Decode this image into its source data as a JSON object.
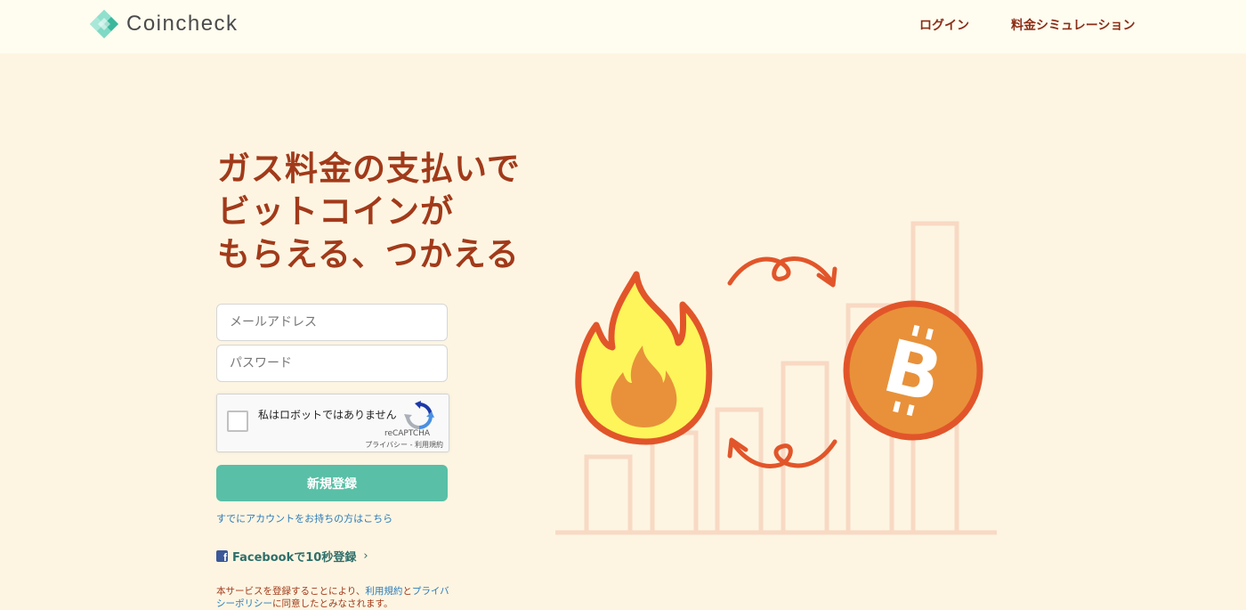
{
  "header": {
    "logo_text": "Coincheck",
    "nav": {
      "login": "ログイン",
      "fee_simulation": "料金シミュレーション"
    }
  },
  "hero": {
    "headline_lines": [
      "ガス料金の支払いで",
      "ビットコインが",
      "もらえる、つかえる"
    ]
  },
  "form": {
    "email_placeholder": "メールアドレス",
    "password_placeholder": "パスワード",
    "captcha": {
      "label": "私はロボットではありません",
      "brand": "reCAPTCHA",
      "terms": "プライバシー - 利用規約"
    },
    "register_label": "新規登録",
    "existing_account_link": "すでにアカウントをお持ちの方はこちら",
    "facebook_label": "Facebookで10秒登録",
    "facebook_chevron": "›"
  },
  "terms": {
    "prefix": "本サービスを登録することにより、",
    "terms_link": "利用規約",
    "and": "と",
    "privacy_link": "プライバシーポリシー",
    "suffix": "に同意したとみなされます。"
  },
  "colors": {
    "background": "#fdf5e2",
    "header_bg": "#fffcf0",
    "headline": "#a13a1a",
    "accent_green": "#59bfa6",
    "link_blue": "#2b7bb9",
    "bitcoin_orange": "#e8913a",
    "flame_outline": "#e2552a",
    "flame_fill": "#fdf55a"
  }
}
